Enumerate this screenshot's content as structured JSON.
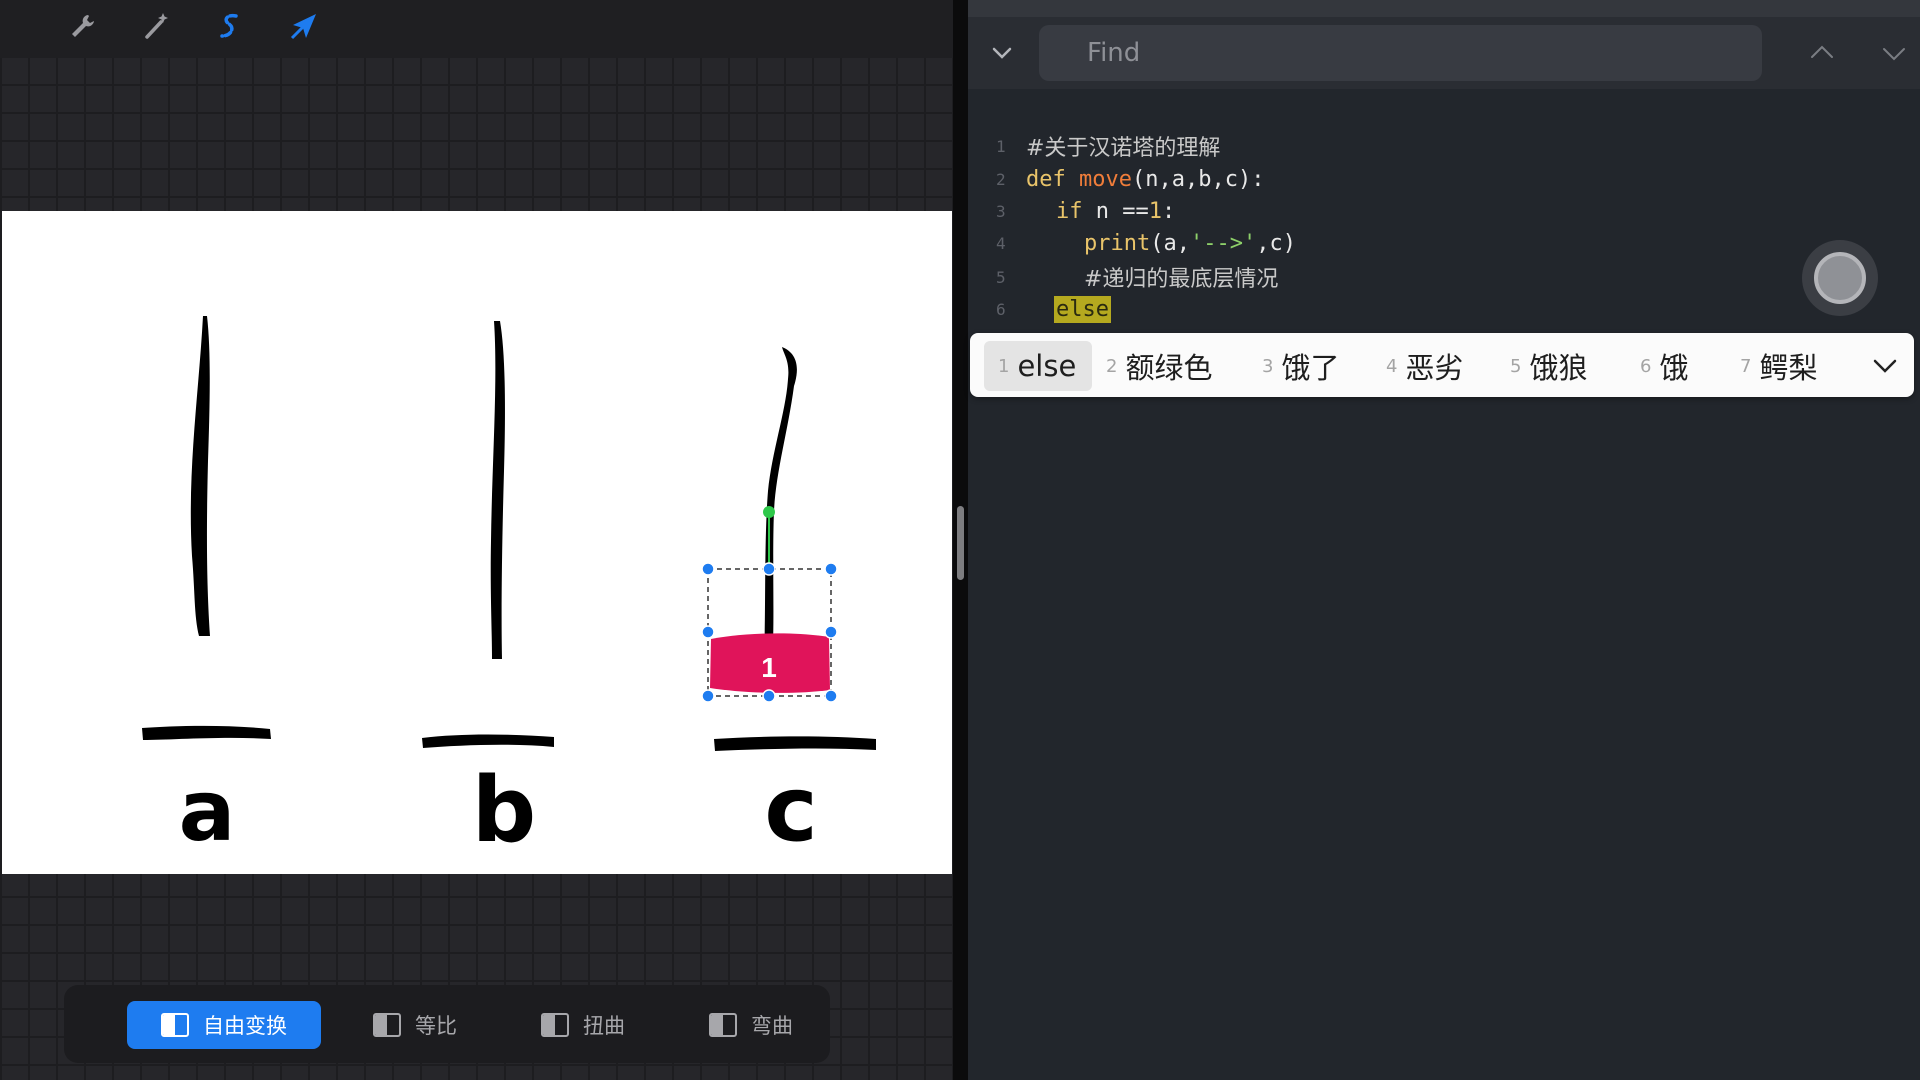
{
  "left_panel": {
    "toolbar": {
      "tools": [
        {
          "name": "wrench-icon",
          "color": "#9a9a9f"
        },
        {
          "name": "magic-wand-icon",
          "color": "#9a9a9f"
        },
        {
          "name": "selection-icon",
          "color": "#1e7cf0"
        },
        {
          "name": "transform-arrow-icon",
          "color": "#1e7cf0"
        }
      ]
    },
    "canvas": {
      "peg_labels": [
        "a",
        "b",
        "c"
      ],
      "disk_label": "1",
      "disk_color": "#e0145a",
      "selection_color": "#1e7cf0",
      "rotation_handle_color": "#2ec84a"
    },
    "transform_modes": [
      {
        "label": "自由变换",
        "active": true
      },
      {
        "label": "等比",
        "active": false
      },
      {
        "label": "扭曲",
        "active": false
      },
      {
        "label": "弯曲",
        "active": false
      }
    ],
    "accent_color": "#1e7cf0"
  },
  "editor": {
    "find": {
      "placeholder": "Find",
      "value": ""
    },
    "lines": [
      {
        "no": "1"
      },
      {
        "no": "2"
      },
      {
        "no": "3"
      },
      {
        "no": "4"
      },
      {
        "no": "5"
      },
      {
        "no": "6"
      }
    ],
    "code": {
      "l1_comment": "#关于汉诺塔的理解",
      "l2_def": "def",
      "l2_fn": "move",
      "l2_args": "(n,a,b,c):",
      "l3_if": "if",
      "l3_cond": " n ==",
      "l3_num": "1",
      "l3_colon": ":",
      "l4_print": "print",
      "l4_open": "(a,",
      "l4_str": "'-->'",
      "l4_close": ",c)",
      "l5_comment": "#递归的最底层情况",
      "l6_else": "else"
    },
    "ime_candidates": [
      {
        "index": "1",
        "word": "else"
      },
      {
        "index": "2",
        "word": "额绿色"
      },
      {
        "index": "3",
        "word": "饿了"
      },
      {
        "index": "4",
        "word": "恶劣"
      },
      {
        "index": "5",
        "word": "饿狼"
      },
      {
        "index": "6",
        "word": "饿"
      },
      {
        "index": "7",
        "word": "鳄梨"
      }
    ]
  }
}
